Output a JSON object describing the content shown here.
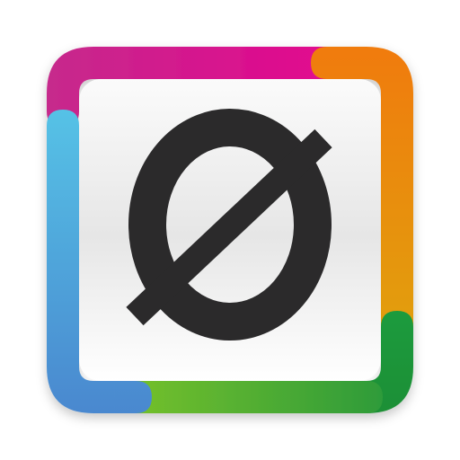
{
  "icon": {
    "name": "empty-set-app-icon",
    "glyph": "Ø",
    "glyph_color": "#2b2a2b",
    "background_colors": {
      "top": "#fbfbfb",
      "middle": "#e6e6e6",
      "bottom": "#ffffff"
    },
    "frame_colors": {
      "top": [
        "#c62a8c",
        "#e3058f"
      ],
      "right": [
        "#f07b10",
        "#e1a010"
      ],
      "bottom_right": [
        "#1e9b3d",
        "#1f8f36"
      ],
      "bottom": [
        "#78c22a",
        "#2e9b3a"
      ],
      "left": [
        "#55c2e6",
        "#4a88cf"
      ]
    }
  }
}
